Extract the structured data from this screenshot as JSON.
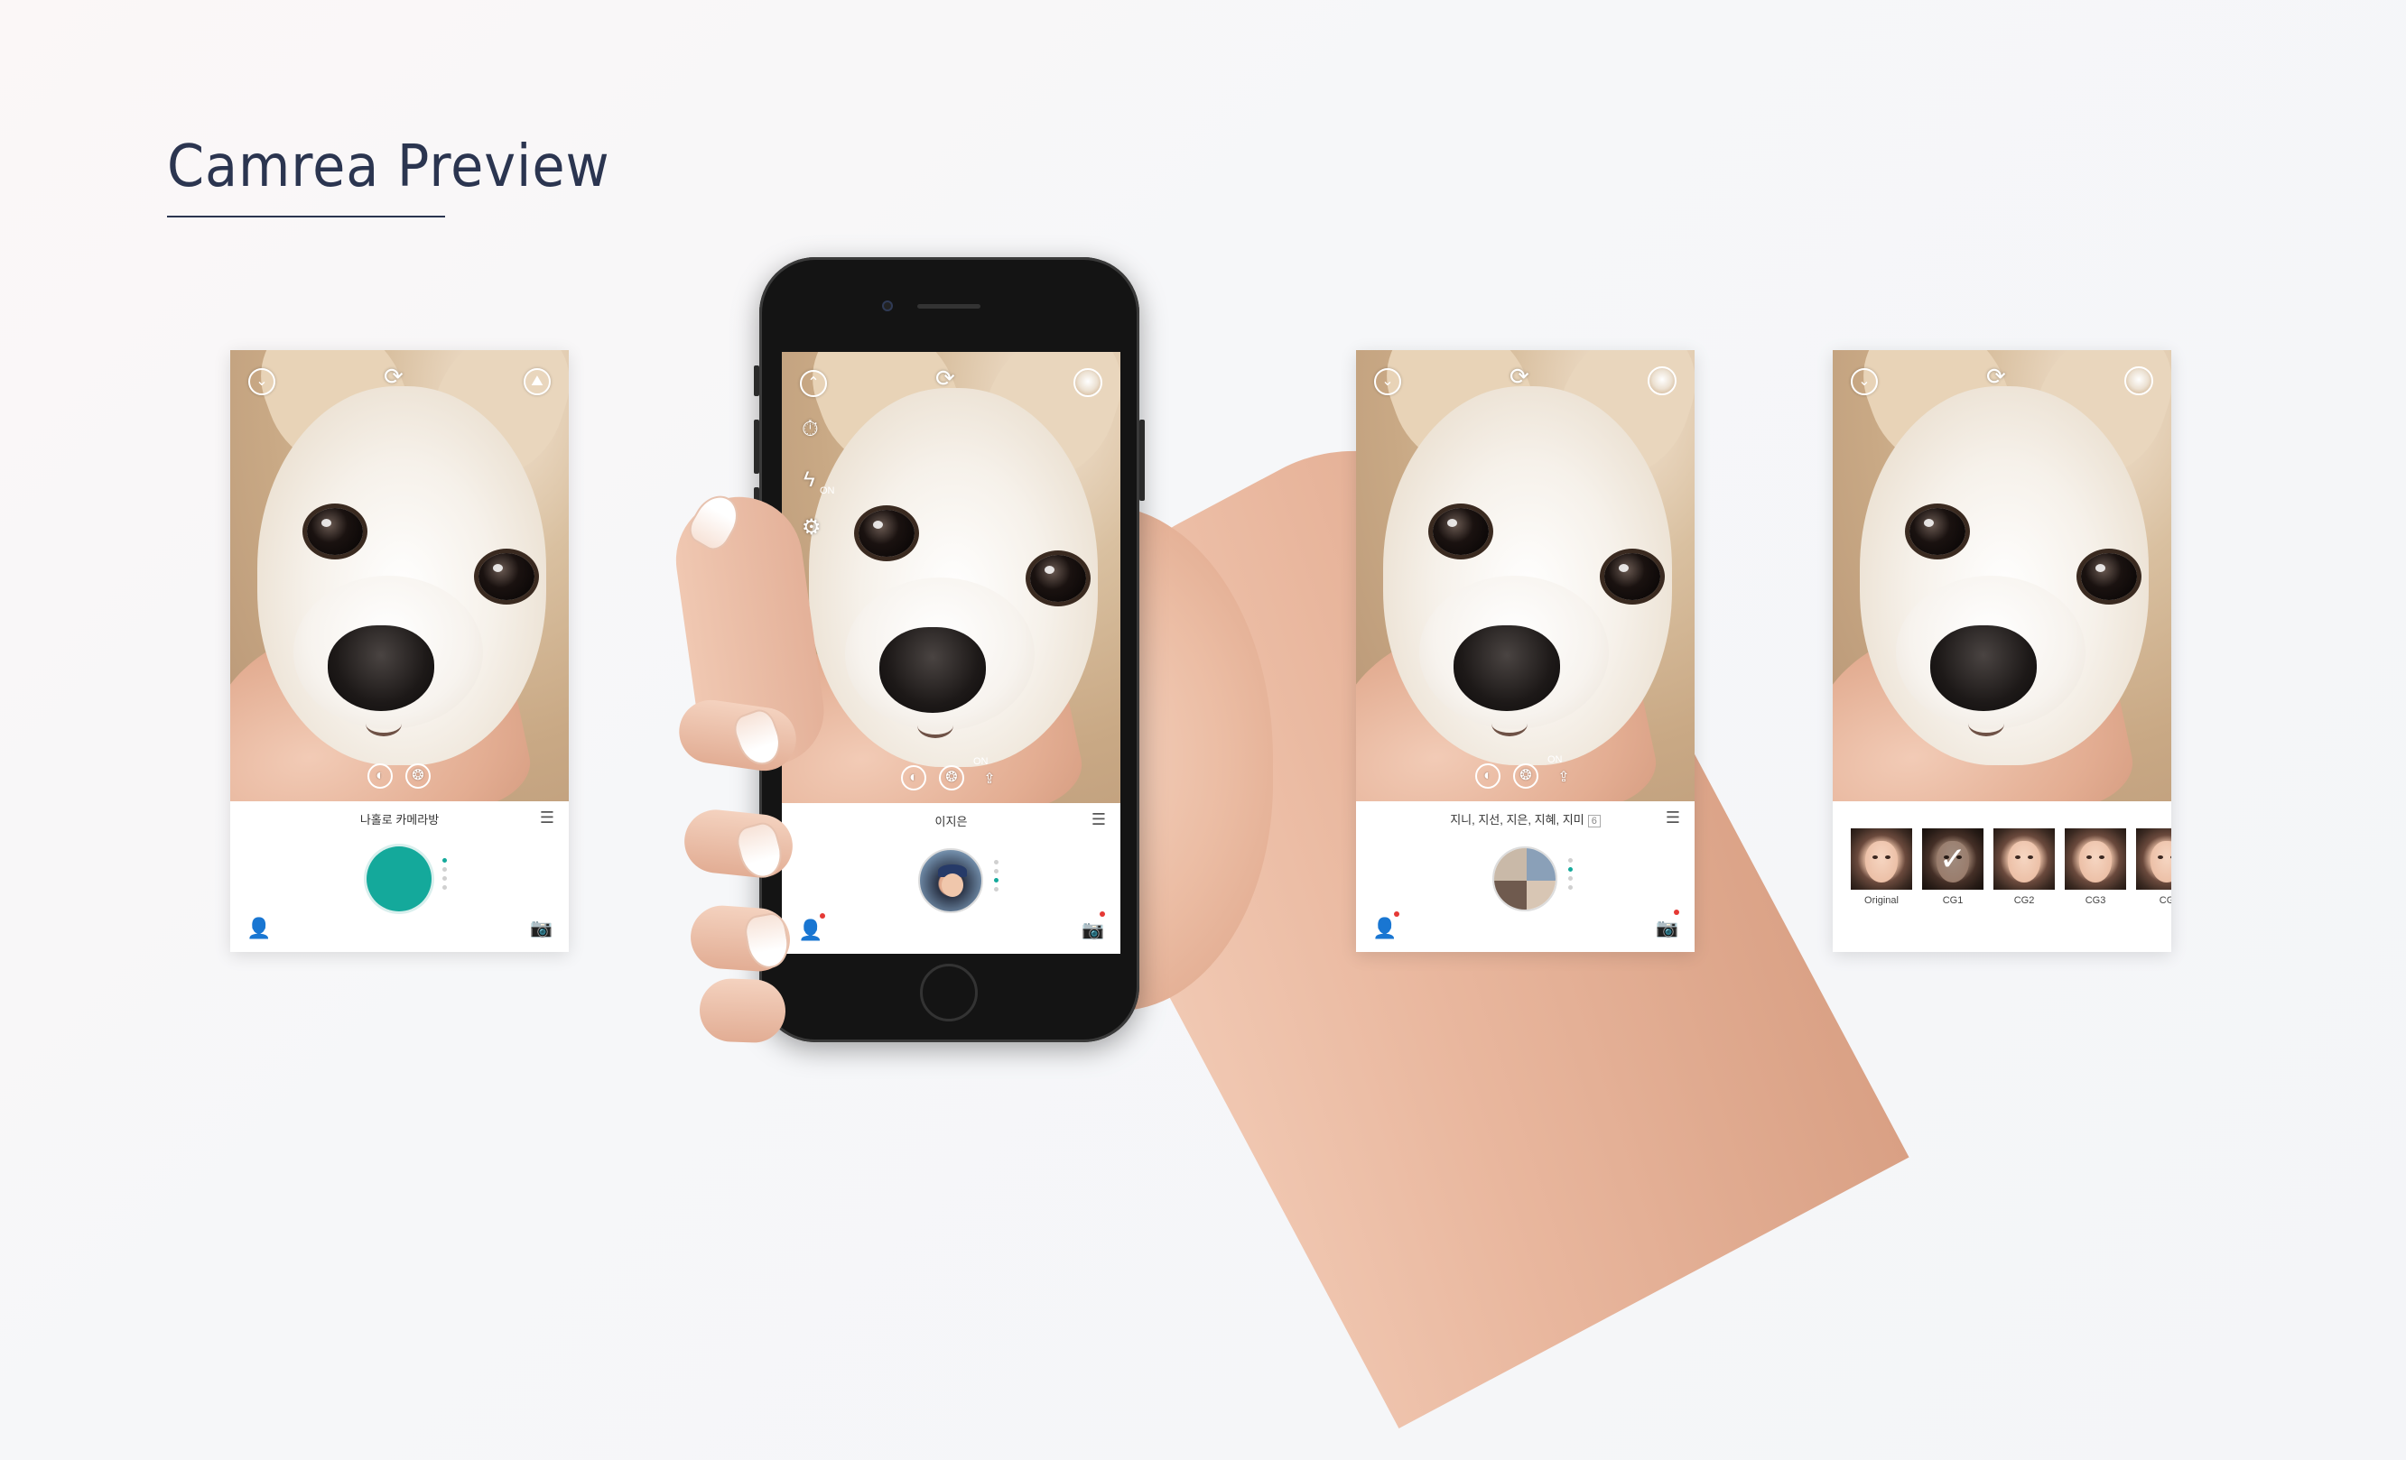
{
  "page": {
    "title": "Camrea Preview"
  },
  "screens": {
    "s1": {
      "bottom_title": "나홀로 카메라방"
    },
    "s2": {
      "bottom_title": "이지은",
      "flash_label": "ON",
      "filter_on": "ON"
    },
    "s3": {
      "bottom_title": "지니, 지선, 지은, 지혜, 지미",
      "count": "6",
      "filter_on": "ON"
    },
    "s4": {
      "filters": [
        {
          "label": "Original"
        },
        {
          "label": "CG1"
        },
        {
          "label": "CG2"
        },
        {
          "label": "CG3"
        },
        {
          "label": "CG"
        }
      ]
    }
  },
  "colors": {
    "accent": "#14a99b",
    "title": "#2b3550",
    "alert": "#e53935"
  },
  "icons": [
    "chevron-down-icon",
    "switch-camera-icon",
    "gallery-icon",
    "timer-icon",
    "flash-icon",
    "settings-icon",
    "sticker-icon",
    "filter-icon",
    "list-icon",
    "user-icon",
    "camera-list-icon"
  ]
}
